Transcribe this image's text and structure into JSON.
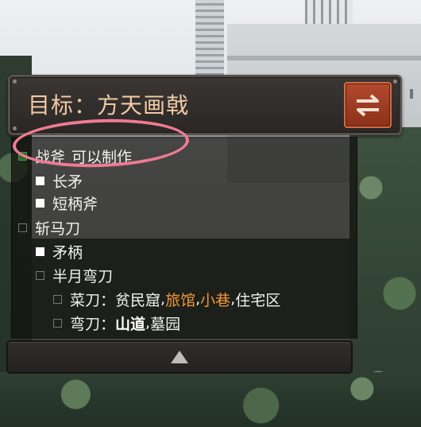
{
  "header": {
    "title": "目标：方天画戟"
  },
  "annotation": {
    "ring_color": "#ef7a93"
  },
  "recipe_tree": [
    {
      "label": "战斧",
      "status": "可以制作",
      "checkbox": "green"
    },
    {
      "label": "长矛",
      "checkbox": "filled"
    },
    {
      "label": "短柄斧",
      "checkbox": "filled"
    },
    {
      "label": "斩马刀",
      "checkbox": "empty"
    },
    {
      "label": "矛柄",
      "checkbox": "filled"
    },
    {
      "label": "半月弯刀",
      "checkbox": "empty"
    },
    {
      "label": "菜刀：",
      "checkbox": "empty",
      "locations": [
        {
          "name": "贫民窟",
          "sep": ", ",
          "style": "normal"
        },
        {
          "name": "旅馆",
          "sep": ", ",
          "style": "orange"
        },
        {
          "name": "小巷",
          "sep": ", ",
          "style": "orange"
        },
        {
          "name": "住宅区",
          "sep": "",
          "style": "normal"
        }
      ]
    },
    {
      "label": "弯刀：",
      "checkbox": "empty",
      "locations": [
        {
          "name": "山道",
          "sep": ", ",
          "style": "bold"
        },
        {
          "name": "墓园",
          "sep": "",
          "style": "normal"
        }
      ]
    }
  ],
  "colors": {
    "title_text": "#f0c9a6",
    "swap_button": "#a3401f",
    "location_highlight": "#f0963a",
    "status_green": "#2d6a2a"
  },
  "icons": {
    "swap": "swap-arrows-icon",
    "collapse": "triangle-up-icon"
  }
}
